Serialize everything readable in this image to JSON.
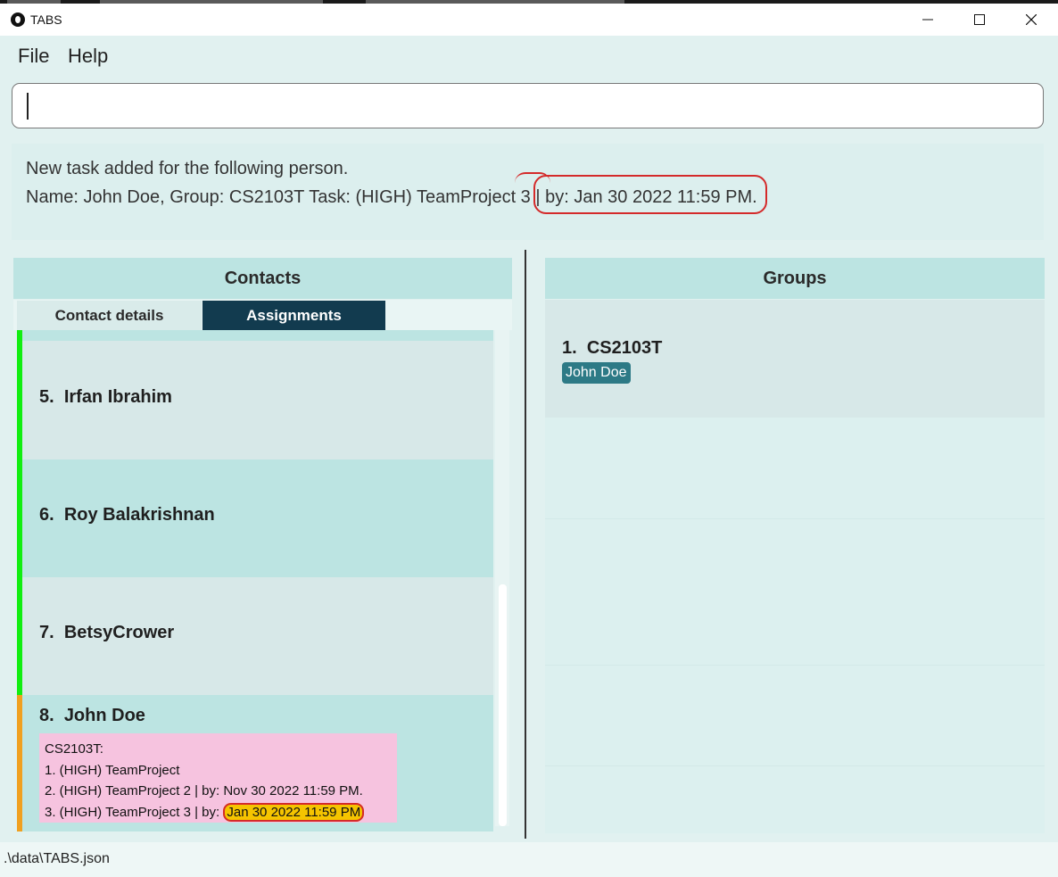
{
  "window": {
    "title": "TABS",
    "icon": "app-logo-icon"
  },
  "menu": [
    "File",
    "Help"
  ],
  "command_box": {
    "value": ""
  },
  "result": {
    "line1": "New task added for the following person.",
    "line2": "Name: John Doe, Group: CS2103T Task: (HIGH) TeamProject 3 | by: Jan 30 2022 11:59 PM."
  },
  "contacts": {
    "header": "Contacts",
    "tabs": [
      "Contact details",
      "Assignments"
    ],
    "active_tab": "Assignments",
    "cards": [
      {
        "index": "5.",
        "name": "Irfan Ibrahim",
        "status_color": "#11ee11"
      },
      {
        "index": "6.",
        "name": "Roy Balakrishnan",
        "status_color": "#11ee11"
      },
      {
        "index": "7.",
        "name": "BetsyCrower",
        "status_color": "#11ee11"
      },
      {
        "index": "8.",
        "name": "John Doe",
        "status_color": "#f0a020",
        "assignments": {
          "group": "CS2103T:",
          "tasks": [
            "1. (HIGH) TeamProject",
            "2. (HIGH) TeamProject 2 | by: Nov 30 2022 11:59 PM.",
            {
              "prefix": "3. (HIGH) TeamProject 3 | by: ",
              "highlight": "Jan 30 2022 11:59 PM"
            }
          ]
        }
      }
    ]
  },
  "groups": {
    "header": "Groups",
    "items": [
      {
        "index": "1.",
        "name": "CS2103T",
        "members": [
          "John Doe"
        ]
      }
    ]
  },
  "status_bar": {
    "path": ".\\data\\TABS.json"
  }
}
